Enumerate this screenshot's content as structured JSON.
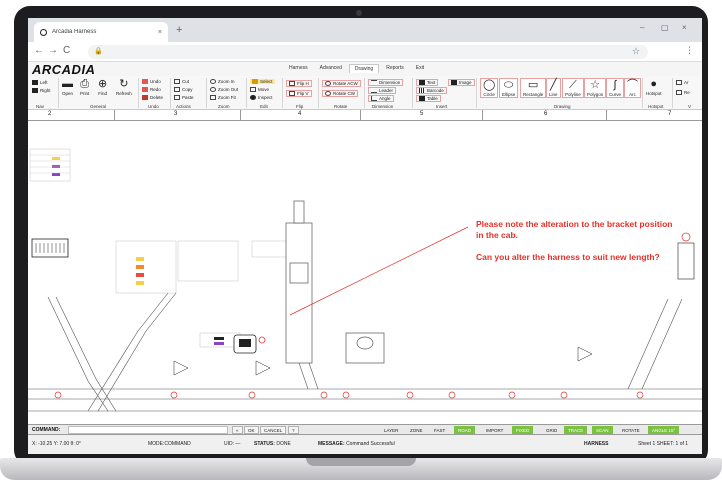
{
  "browser": {
    "tab_title": "Arcadia Harness",
    "tab_close": "×",
    "new_tab": "+",
    "window_minimize": "–",
    "window_maximize": "▢",
    "window_close": "×",
    "back": "←",
    "forward": "→",
    "reload": "C",
    "lock": "🔒",
    "bookmark": "☆",
    "menu": "⋮"
  },
  "app": {
    "logo": "ARCADIA",
    "menu_tabs": [
      {
        "label": "Harness",
        "active": false
      },
      {
        "label": "Advanced",
        "active": false
      },
      {
        "label": "Drawing",
        "active": true
      },
      {
        "label": "Reports",
        "active": false
      },
      {
        "label": "Exit",
        "active": false
      }
    ]
  },
  "ribbon": {
    "nav": {
      "left": "Left",
      "right": "Right",
      "group": "Nav"
    },
    "general": {
      "open": "Open",
      "print": "Print",
      "find": "Find",
      "refresh": "Refresh",
      "group": "General"
    },
    "undo": {
      "undo": "Undo",
      "redo": "Redo",
      "delete": "Delete",
      "group": "Undo"
    },
    "actions": {
      "cut": "Cut",
      "copy": "Copy",
      "paste": "Paste",
      "group": "Actions"
    },
    "zoom": {
      "zoom_in": "Zoom In",
      "zoom_out": "Zoom Out",
      "zoom_fit": "Zoom Fit",
      "group": "Zoom"
    },
    "edit": {
      "select": "Select",
      "move": "Move",
      "inspect": "Inspect",
      "group": "Edit"
    },
    "flip": {
      "flip_h": "Flip H",
      "flip_v": "Flip V",
      "group": "Flip"
    },
    "rotate": {
      "acw": "Rotate ACW",
      "cw": "Rotate CW",
      "group": "Rotate"
    },
    "dimension": {
      "dimension": "Dimension",
      "leader": "Leader",
      "angle": "Angle",
      "group": "Dimension"
    },
    "insert": {
      "text": "Text",
      "barcode": "Barcode",
      "table": "Table",
      "image": "Image",
      "group": "Insert"
    },
    "drawing": {
      "circle": "Circle",
      "ellipse": "Ellipse",
      "rectangle": "Rectangle",
      "line": "Line",
      "polyline": "Polyline",
      "polygon": "Polygon",
      "curve": "Curve",
      "arc": "Arc",
      "group": "Drawing"
    },
    "hotspot": {
      "hotspot": "Hotspot",
      "group": "Hotspot"
    },
    "more": {
      "item1": "Ar",
      "item2": "Re",
      "group": "V"
    }
  },
  "ruler": {
    "labels": [
      "2",
      "3",
      "4",
      "5",
      "6",
      "7"
    ]
  },
  "note": {
    "line1": "Please note the alteration to the bracket position in the cab.",
    "line2": "Can you alter the harness to suit new length?"
  },
  "cmdbar": {
    "label": "COMMAND:",
    "buttons": [
      "«",
      "OK",
      "CANCEL",
      "?"
    ],
    "modes": [
      {
        "label": "LAYER",
        "on": false
      },
      {
        "label": "ZONE",
        "on": false
      },
      {
        "label": "FAST",
        "on": false
      },
      {
        "label": "ROAD",
        "on": true
      },
      {
        "label": "IMPORT",
        "on": false
      },
      {
        "label": "FIXED",
        "on": true
      },
      {
        "label": "GRID",
        "on": false
      },
      {
        "label": "TRACE",
        "on": true
      },
      {
        "label": "SCAN",
        "on": true
      },
      {
        "label": "ROTATE",
        "on": false
      },
      {
        "label": "ANGLE 15°",
        "on": true
      }
    ]
  },
  "status": {
    "coords": "X: -10.25 Y: 7.00 θ: 0°",
    "mode": "MODE:COMMAND",
    "uid": "UID: —",
    "status_label": "STATUS:",
    "status_value": "DONE",
    "message_label": "MESSAGE:",
    "message_value": "Command Successful",
    "product": "HARNESS",
    "sheet": "Sheet 1 SHEET: 1 of 1"
  },
  "colors": {
    "note_red": "#e4312b",
    "mode_green": "#7bc142",
    "ribbon_accent": "#e7a3a3"
  }
}
